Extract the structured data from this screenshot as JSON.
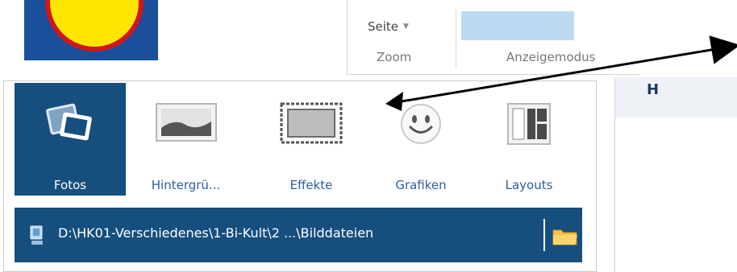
{
  "ribbon": {
    "seite_label": "Seite",
    "zoom_group_label": "Zoom",
    "anzeigemodus_group_label": "Anzeigemodus"
  },
  "tabs": [
    {
      "label": "Fotos",
      "icon": "photos-icon",
      "selected": true
    },
    {
      "label": "Hintergrü...",
      "icon": "landscape-icon",
      "selected": false
    },
    {
      "label": "Effekte",
      "icon": "frame-icon",
      "selected": false
    },
    {
      "label": "Grafiken",
      "icon": "smiley-icon",
      "selected": false
    },
    {
      "label": "Layouts",
      "icon": "layout-icon",
      "selected": false
    }
  ],
  "path_bar": {
    "path": "D:\\HK01-Verschiedenes\\1-Bi-Kult\\2 ...\\Bilddateien",
    "computer_icon": "computer-icon",
    "folder_icon": "folder-icon"
  },
  "right_panel": {
    "header_partial": "H"
  },
  "colors": {
    "selected_tab_bg": "#164e7e",
    "tab_label": "#2d5da8",
    "display_mode_fill": "#bcdaf2"
  }
}
